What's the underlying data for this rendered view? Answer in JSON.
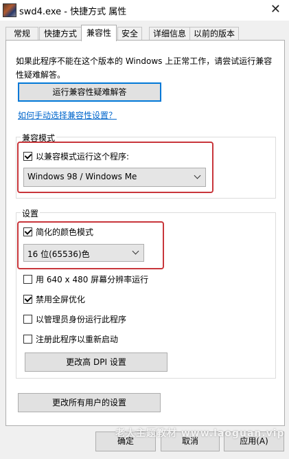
{
  "window": {
    "title": "swd4.exe - 快捷方式 属性",
    "close_glyph": "✕",
    "app_icon": "swd4-game-icon"
  },
  "tabs": [
    {
      "label": "常规"
    },
    {
      "label": "快捷方式"
    },
    {
      "label": "兼容性",
      "active": true
    },
    {
      "label": "安全"
    },
    {
      "label": "详细信息"
    },
    {
      "label": "以前的版本"
    }
  ],
  "compat": {
    "description": "如果此程序不能在这个版本的 Windows 上正常工作，请尝试运行兼容性疑难解答。",
    "troubleshoot_button": "运行兼容性疑难解答",
    "manual_link": "如何手动选择兼容性设置？"
  },
  "compat_mode": {
    "group_label": "兼容模式",
    "checkbox_label": "以兼容模式运行这个程序:",
    "checked": true,
    "selected_os": "Windows 98 / Windows Me"
  },
  "settings": {
    "group_label": "设置",
    "reduced_color_label": "简化的颜色模式",
    "reduced_color_checked": true,
    "color_value": "16 位(65536)色",
    "res640_label": "用 640 x 480 屏幕分辨率运行",
    "res640_checked": false,
    "disable_fullscreen_label": "禁用全屏优化",
    "disable_fullscreen_checked": true,
    "run_admin_label": "以管理员身份运行此程序",
    "run_admin_checked": false,
    "register_restart_label": "注册此程序以重新启动",
    "register_restart_checked": false,
    "dpi_button": "更改高 DPI 设置"
  },
  "all_users_button": "更改所有用户的设置",
  "footer": {
    "ok": "确定",
    "cancel": "取消",
    "apply": "应用(A)"
  },
  "watermark": "老大主题教材  www.laoguan.vip",
  "colors": {
    "highlight_border": "#c8353a",
    "link": "#0066cc",
    "focus_border": "#0078d7"
  }
}
